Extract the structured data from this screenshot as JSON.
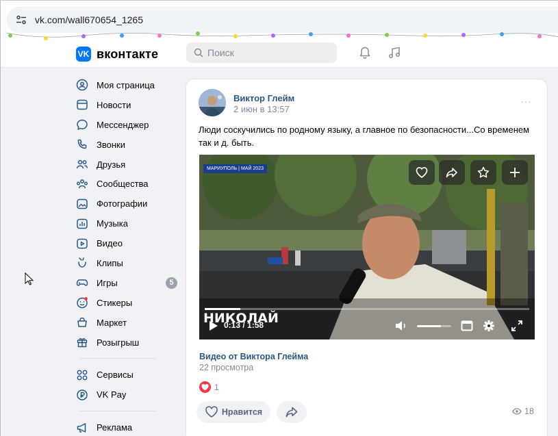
{
  "browser": {
    "url": "vk.com/wall670654_1265"
  },
  "header": {
    "logo_mark": "VK",
    "logo_text": "вконтакте",
    "search_placeholder": "Поиск",
    "icons": [
      "bell-icon",
      "music-note-icon"
    ]
  },
  "sidebar": {
    "items": [
      {
        "label": "Моя страница",
        "icon": "profile-icon"
      },
      {
        "label": "Новости",
        "icon": "news-icon"
      },
      {
        "label": "Мессенджер",
        "icon": "chat-bubble-icon"
      },
      {
        "label": "Звонки",
        "icon": "phone-icon"
      },
      {
        "label": "Друзья",
        "icon": "friends-icon"
      },
      {
        "label": "Сообщества",
        "icon": "communities-icon"
      },
      {
        "label": "Фотографии",
        "icon": "photo-icon"
      },
      {
        "label": "Музыка",
        "icon": "music-icon"
      },
      {
        "label": "Видео",
        "icon": "video-icon"
      },
      {
        "label": "Клипы",
        "icon": "clips-icon"
      },
      {
        "label": "Игры",
        "icon": "gamepad-icon",
        "badge": "5"
      },
      {
        "label": "Стикеры",
        "icon": "sticker-icon"
      },
      {
        "label": "Маркет",
        "icon": "bag-icon"
      },
      {
        "label": "Розыгрыш",
        "icon": "gift-icon"
      }
    ],
    "items2": [
      {
        "label": "Сервисы",
        "icon": "services-icon"
      },
      {
        "label": "VK Pay",
        "icon": "ruble-icon"
      }
    ],
    "items3": [
      {
        "label": "Реклама",
        "icon": "megaphone-icon"
      }
    ]
  },
  "post": {
    "author": "Виктор Глейм",
    "date": "2 июн в 13:57",
    "more": "···",
    "text": "Люди соскучились по родному языку, а главное по безопасности...Со временем так и д. быть.",
    "video": {
      "tag": "МАРИУПОЛЬ | МАЙ 2023",
      "caption_name": "НИКОЛАЙ",
      "time_current": "0:13",
      "time_total": "1:58",
      "time_display": "0:13 / 1:58",
      "progress": 0.11,
      "volume": 0.7
    },
    "video_title": "Видео от Виктора Глейма",
    "views": "22 просмотра",
    "likes_count": "1",
    "like_label": "Нравится",
    "view_count": "18"
  },
  "colors": {
    "accent": "#0077ff",
    "link": "#2a5885",
    "like_red": "#ff3347"
  }
}
